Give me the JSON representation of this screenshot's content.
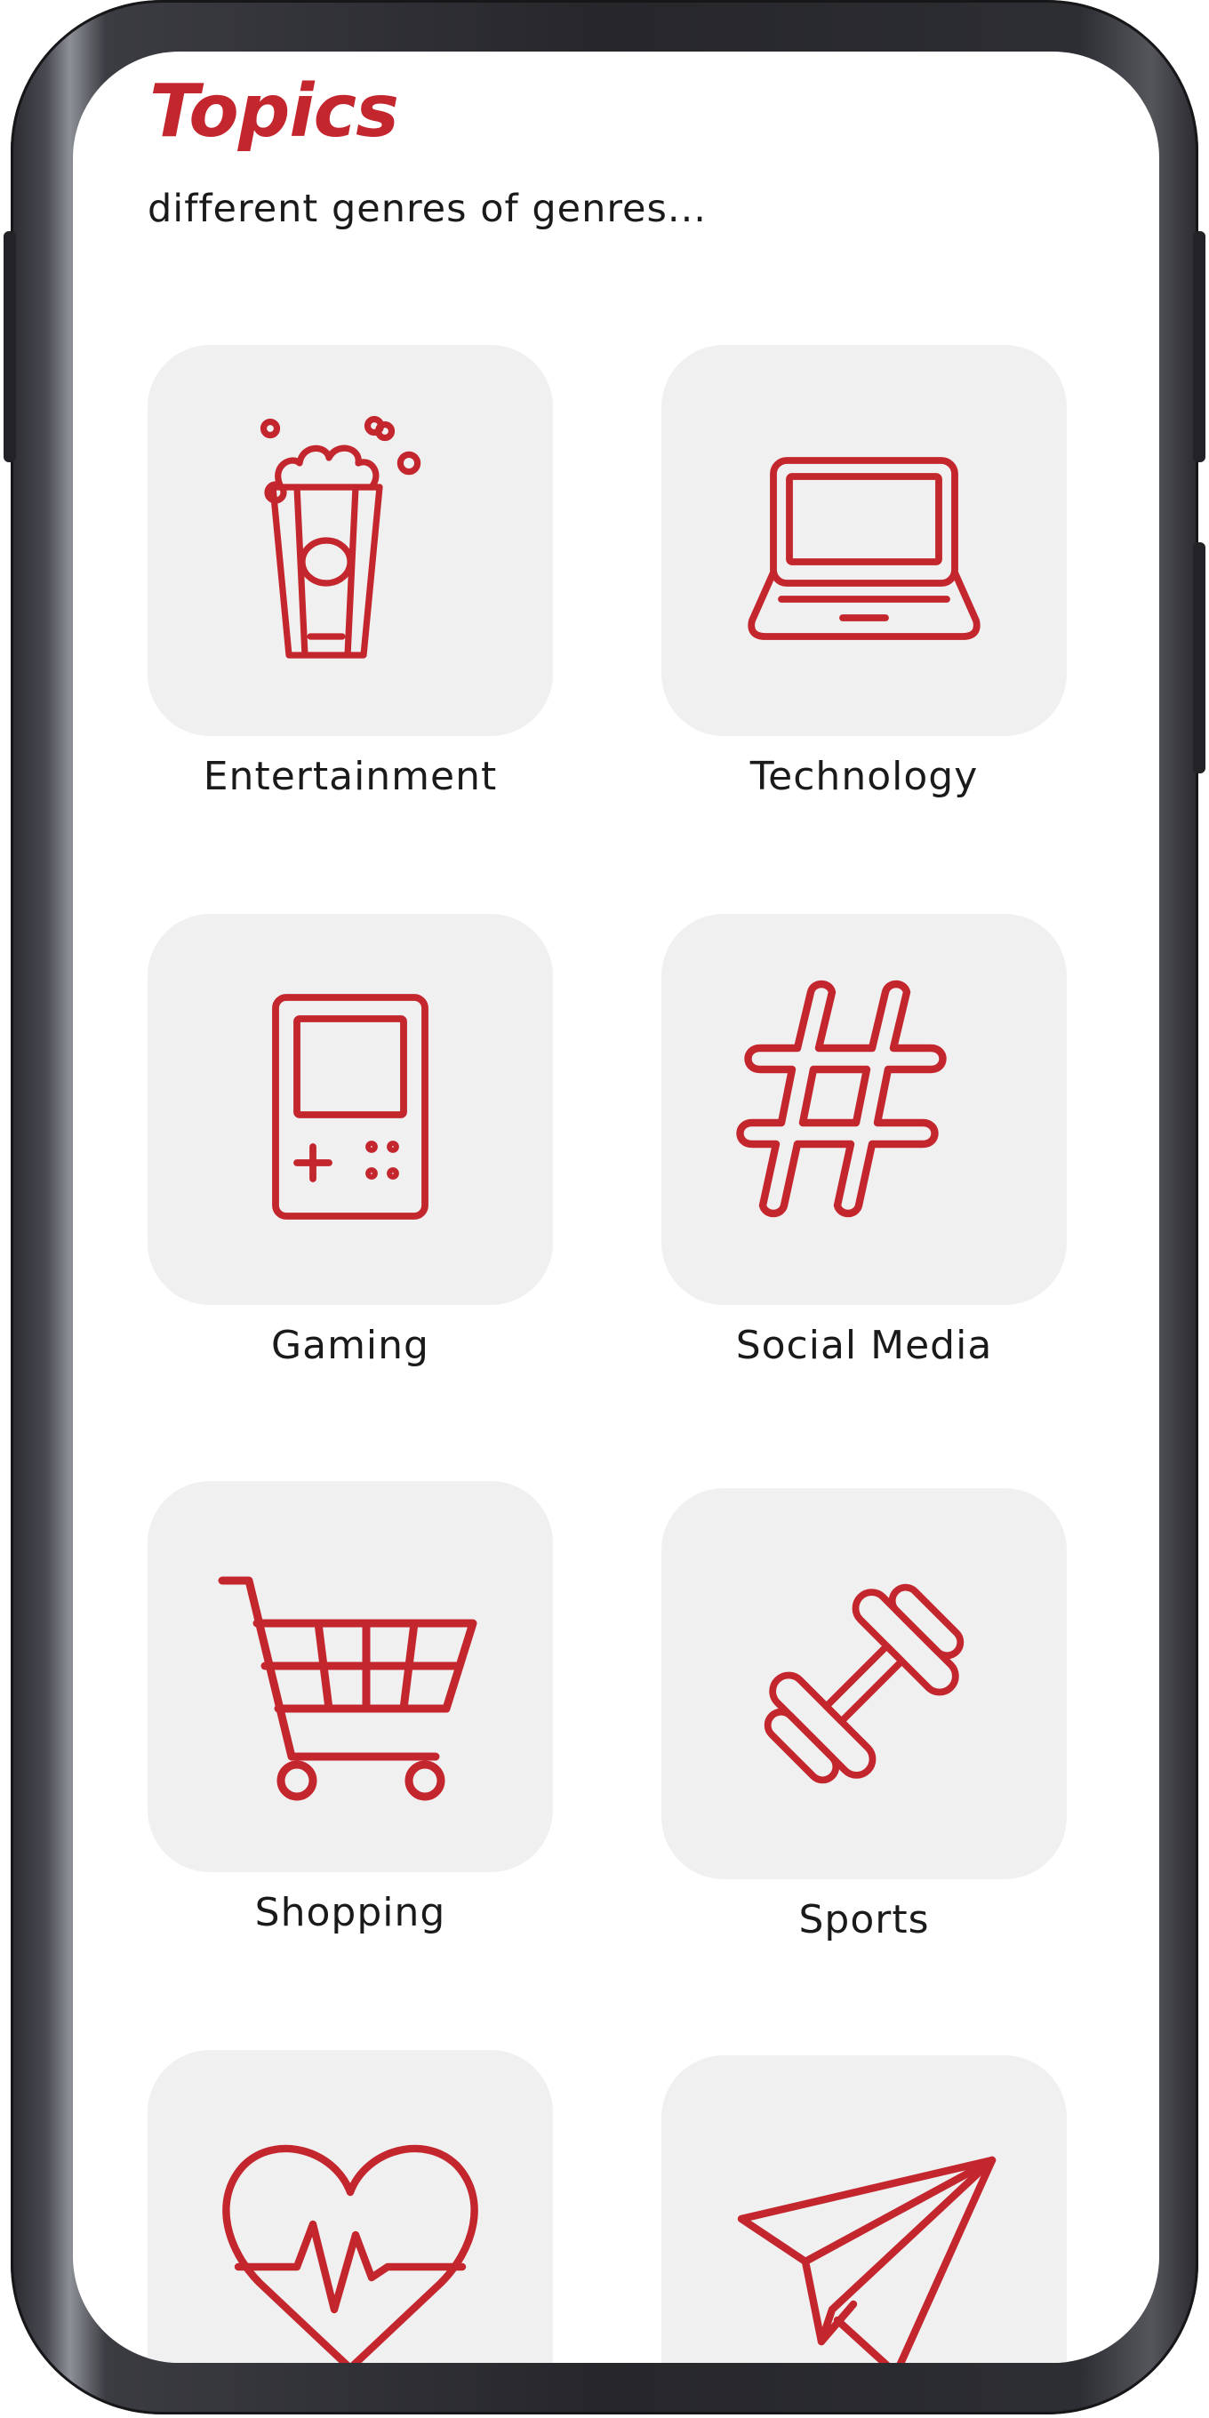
{
  "header": {
    "title": "Topics",
    "subtitle": "different genres of genres..."
  },
  "accent_color": "#c4262e",
  "tile_color": "#f1f0f0",
  "topics": [
    {
      "label": "Entertainment",
      "icon": "popcorn-icon"
    },
    {
      "label": "Technology",
      "icon": "laptop-icon"
    },
    {
      "label": "Gaming",
      "icon": "handheld-console-icon"
    },
    {
      "label": "Social Media",
      "icon": "hashtag-icon"
    },
    {
      "label": "Shopping",
      "icon": "shopping-cart-icon"
    },
    {
      "label": "Sports",
      "icon": "dumbbell-icon"
    },
    {
      "label": "",
      "icon": "heart-pulse-icon"
    },
    {
      "label": "",
      "icon": "paper-plane-icon"
    }
  ]
}
